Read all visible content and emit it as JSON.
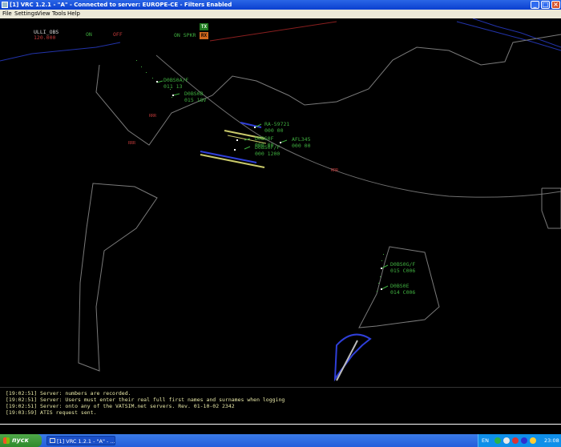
{
  "window": {
    "title": "[1] VRC 1.2.1 - \"A\" - Connected to server: EUROPE-CE - Filters Enabled",
    "buttons": {
      "minimize": "_",
      "maximize": "□",
      "close": "×"
    }
  },
  "menu": {
    "items": [
      "File",
      "Settings",
      "View",
      "Tools",
      "Help"
    ]
  },
  "header": {
    "callsign": "ULLI_OBS",
    "frequency": "120.000",
    "on_label": "ON",
    "off_label": "OFF",
    "spkr_label": "ON SPKR",
    "tx_label": "TX",
    "rx_label": "RX"
  },
  "aircraft": [
    {
      "line1": "D0BS0A/F",
      "line2": "011 13"
    },
    {
      "line1": "D0BS0B",
      "line2": "015 18V"
    },
    {
      "line1": "RA-59721",
      "line2": "000 00"
    },
    {
      "line1": "D0BS0F",
      "line2": "000 00"
    },
    {
      "line1": "AFL345",
      "line2": "000 00"
    },
    {
      "line1": "D0BS0F/F",
      "line2": "000 1200"
    },
    {
      "line1": "D0BS0G/F",
      "line2": "015 C006"
    },
    {
      "line1": "D0BS0E",
      "line2": "014 C006"
    }
  ],
  "fixes": [
    "RRR",
    "RRR",
    "RRR"
  ],
  "log": [
    "[19:02:51] Server: numbers are recorded.",
    "[19:02:51] Server: Users must enter their real full first names and surnames when logging",
    "[19:02:51] Server: onto any of the VATSIM.net servers. Rev. 01-10-02 2342",
    "[19:03:59] ATIS request sent."
  ],
  "taskbar": {
    "start_label": "пуск",
    "task_label": "[1] VRC 1.2.1 - \"A\" - ...",
    "language": "EN",
    "clock": "23:08"
  },
  "colors": {
    "titlebar": "#0a3fd0",
    "tag_green": "#3fae3f",
    "fix_red": "#c23a3a",
    "log_text": "#e9e9a8",
    "taskbar": "#245edb",
    "start_green": "#2e8a2c"
  }
}
